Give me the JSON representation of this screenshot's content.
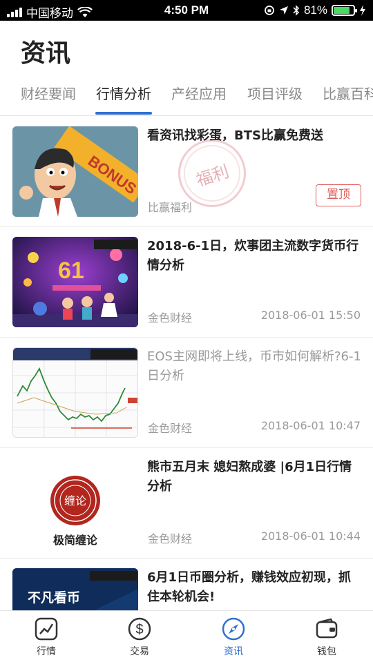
{
  "status_bar": {
    "carrier": "中国移动",
    "time": "4:50 PM",
    "battery": "81%"
  },
  "page_title": "资讯",
  "tabs": [
    {
      "label": "财经要闻",
      "active": false
    },
    {
      "label": "行情分析",
      "active": true
    },
    {
      "label": "产经应用",
      "active": false
    },
    {
      "label": "项目评级",
      "active": false
    },
    {
      "label": "比赢百科",
      "active": false
    }
  ],
  "articles": [
    {
      "title": "看资讯找彩蛋，BTS比赢免费送",
      "source": "比赢福利",
      "time": "",
      "tag": "置顶",
      "stamp": "福利",
      "image_text": "BONUS"
    },
    {
      "title": "2018-6-1日，炊事团主流数字货币行情分析",
      "source": "金色财经",
      "time": "2018-06-01 15:50"
    },
    {
      "title": "EOS主网即将上线，币市如何解析?6-1日分析",
      "source": "金色财经",
      "time": "2018-06-01 10:47"
    },
    {
      "title": "熊市五月末 媳妇熬成婆 |6月1日行情分析",
      "source": "金色财经",
      "time": "2018-06-01 10:44",
      "image_text": "极简缠论",
      "seal_text": "缠论"
    },
    {
      "title": "6月1日币圈分析，赚钱效应初现，抓住本轮机会!",
      "source": "",
      "time": "",
      "image_text": "不凡看币"
    }
  ],
  "tab_bar": [
    {
      "label": "行情",
      "icon": "chart-icon",
      "active": false
    },
    {
      "label": "交易",
      "icon": "dollar-icon",
      "active": false
    },
    {
      "label": "资讯",
      "icon": "compass-icon",
      "active": true
    },
    {
      "label": "钱包",
      "icon": "wallet-icon",
      "active": false
    }
  ],
  "colors": {
    "accent": "#2f6fd1",
    "tag_red": "#e05b5b"
  }
}
